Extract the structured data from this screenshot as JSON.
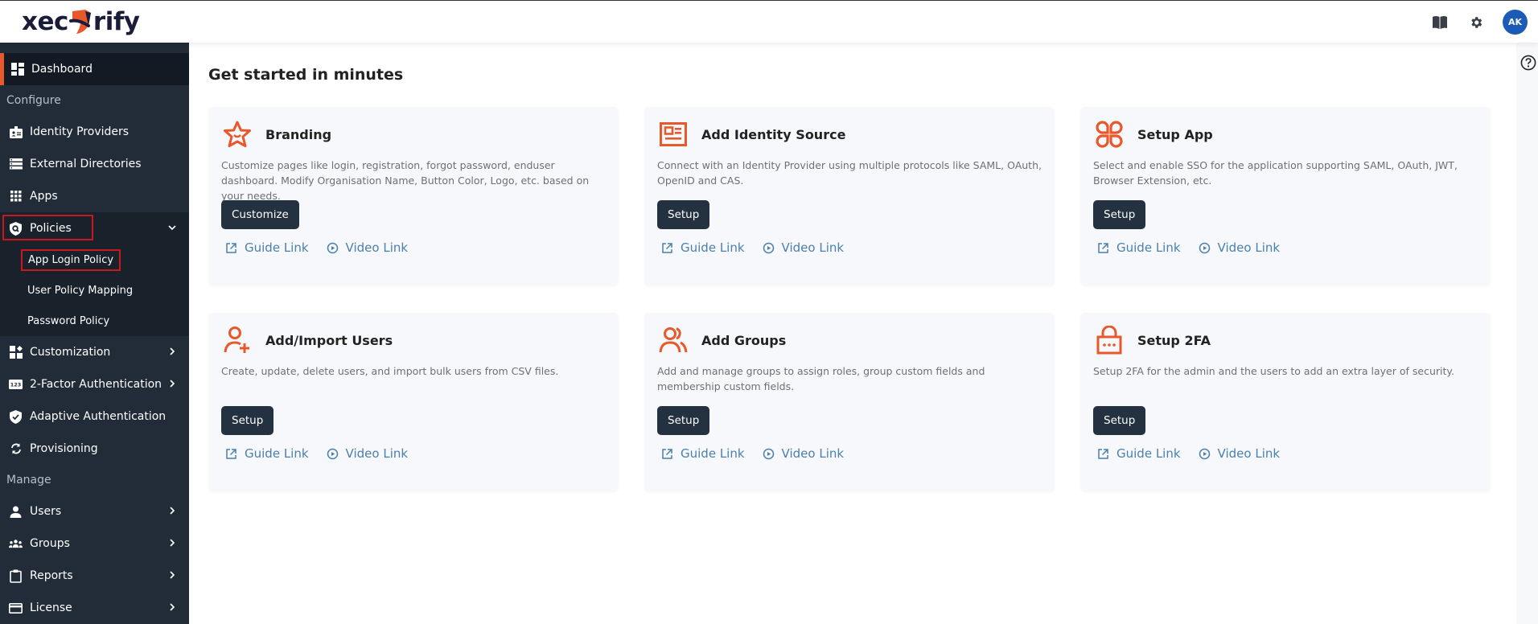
{
  "app": {
    "logo_text_left": "xec",
    "logo_text_right": "rify",
    "brand_color": "#e8582a"
  },
  "topbar": {
    "icons": [
      "book-icon",
      "gear-icon"
    ],
    "avatar_initials": "AK",
    "avatar_color": "#1a5bb5"
  },
  "sidebar": {
    "dashboard": "Dashboard",
    "section_configure": "Configure",
    "configure_items": [
      {
        "label": "Identity Providers",
        "icon": "id-badge-icon"
      },
      {
        "label": "External Directories",
        "icon": "server-icon"
      },
      {
        "label": "Apps",
        "icon": "grid-icon"
      }
    ],
    "policies": {
      "label": "Policies",
      "expanded": true,
      "sub_items": [
        "App Login Policy",
        "User Policy Mapping",
        "Password Policy"
      ],
      "highlighted_sub_item": "App Login Policy"
    },
    "more_configure": [
      {
        "label": "Customization",
        "icon": "widgets-icon",
        "has_chevron": true
      },
      {
        "label": "2-Factor Authentication",
        "icon": "pin-123-icon",
        "has_chevron": true
      },
      {
        "label": "Adaptive Authentication",
        "icon": "shield-check-icon",
        "has_chevron": false
      },
      {
        "label": "Provisioning",
        "icon": "sync-icon",
        "has_chevron": false
      }
    ],
    "section_manage": "Manage",
    "manage_items": [
      {
        "label": "Users",
        "icon": "user-icon"
      },
      {
        "label": "Groups",
        "icon": "groups-icon"
      },
      {
        "label": "Reports",
        "icon": "clipboard-icon"
      },
      {
        "label": "License",
        "icon": "credit-card-icon"
      }
    ]
  },
  "main": {
    "title": "Get started in minutes",
    "guide_link": "Guide Link",
    "video_link": "Video Link",
    "cards": [
      {
        "title": "Branding",
        "icon": "star-icon",
        "desc": "Customize pages like login, registration, forgot password, enduser dashboard. Modify Organisation Name, Button Color, Logo, etc. based on your needs.",
        "button": "Customize"
      },
      {
        "title": "Add Identity Source",
        "icon": "id-card-icon",
        "desc": "Connect with an Identity Provider using multiple protocols like SAML, OAuth, OpenID and CAS.",
        "button": "Setup"
      },
      {
        "title": "Setup App",
        "icon": "apps-icon",
        "desc": "Select and enable SSO for the application supporting SAML, OAuth, JWT, Browser Extension, etc.",
        "button": "Setup"
      },
      {
        "title": "Add/Import Users",
        "icon": "user-add-icon",
        "desc": "Create, update, delete users, and import bulk users from CSV files.",
        "button": "Setup"
      },
      {
        "title": "Add Groups",
        "icon": "users-icon",
        "desc": "Add and manage groups to assign roles, group custom fields and membership custom fields.",
        "button": "Setup"
      },
      {
        "title": "Setup 2FA",
        "icon": "lock-icon",
        "desc": "Setup 2FA for the admin and the users to add an extra layer of security.",
        "button": "Setup"
      }
    ]
  }
}
